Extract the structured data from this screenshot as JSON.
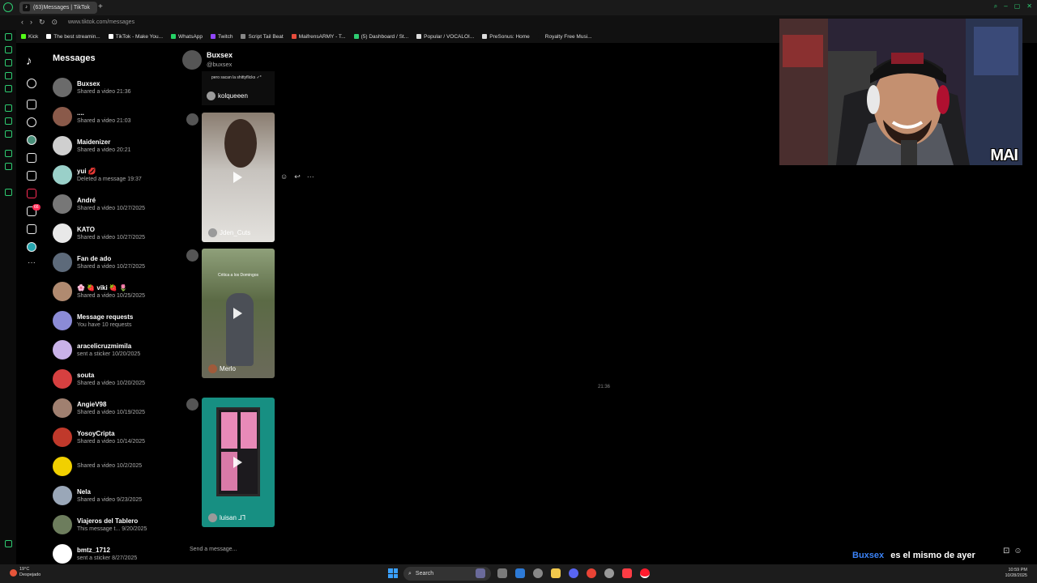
{
  "browser": {
    "tab_title": "(63)Messages | TikTok",
    "url": "www.tiktok.com/messages",
    "bookmarks": [
      {
        "label": "Kick",
        "color": "#53fc18"
      },
      {
        "label": "The best streamin...",
        "color": "#ffffff"
      },
      {
        "label": "TikTok - Make You...",
        "color": "#ffffff"
      },
      {
        "label": "WhatsApp",
        "color": "#25d366"
      },
      {
        "label": "Twitch",
        "color": "#9146ff"
      },
      {
        "label": "Script Tail Beat",
        "color": "#888888"
      },
      {
        "label": "MaifrensARMY - T...",
        "color": "#e74c3c"
      },
      {
        "label": "(5) Dashboard / St...",
        "color": "#2ecc71"
      },
      {
        "label": "Popular / VOCALOI...",
        "color": "#dddddd"
      },
      {
        "label": "PreSonus: Home",
        "color": "#dddddd"
      },
      {
        "label": "Royalty Free Musi...",
        "color": "#111111"
      }
    ]
  },
  "nav": {
    "notification_count": "66"
  },
  "messages": {
    "title": "Messages",
    "conversations": [
      {
        "name": "Buxsex",
        "sub": "Shared a video 21:36",
        "color": "#6b6b6b"
      },
      {
        "name": "....",
        "sub": "Shared a video 21:03",
        "color": "#8a5a4a"
      },
      {
        "name": "Maidenizer",
        "sub": "Shared a video 20:21",
        "color": "#cfcfcf"
      },
      {
        "name": "yui 💋",
        "sub": "Deleted a message 19:37",
        "color": "#9ad0c9"
      },
      {
        "name": "André",
        "sub": "Shared a video 10/27/2025",
        "color": "#777777"
      },
      {
        "name": "KATO",
        "sub": "Shared a video 10/27/2025",
        "color": "#e8e8e8"
      },
      {
        "name": "Fan de ado",
        "sub": "Shared a video 10/27/2025",
        "color": "#5d6a7a"
      },
      {
        "name": "🌸 🍓 viki 🍓 🌷",
        "sub": "Shared a video 10/25/2025",
        "color": "#b08a70"
      },
      {
        "name": "Message requests",
        "sub": "You have 10 requests",
        "color": "#8b8bd6"
      },
      {
        "name": "aracelicruzmimila",
        "sub": "sent a sticker 10/20/2025",
        "color": "#c9b2e8"
      },
      {
        "name": "souta",
        "sub": "Shared a video 10/20/2025",
        "color": "#d64040"
      },
      {
        "name": "AngieV98",
        "sub": "Shared a video 10/19/2025",
        "color": "#a08070"
      },
      {
        "name": "YosoyCripta",
        "sub": "Shared a video 10/14/2025",
        "color": "#c0392b"
      },
      {
        "name": "",
        "sub": "Shared a video 10/2/2025",
        "color": "#f1d000"
      },
      {
        "name": "Nela",
        "sub": "Shared a video 9/23/2025",
        "color": "#9aa7b8"
      },
      {
        "name": "Viajeros del Tablero",
        "sub": "This message t... 9/20/2025",
        "color": "#6d7d5d"
      },
      {
        "name": "bmtz_1712",
        "sub": "sent a sticker 8/27/2025",
        "color": "#ffffff"
      }
    ]
  },
  "chat": {
    "name": "Buxsex",
    "handle": "@buxsex",
    "prev_video": {
      "caption": "pero sacan la shittyflicks ✓*",
      "author": "kolqueeen"
    },
    "videos": [
      {
        "author": "Jden_Cuts",
        "caption": "",
        "bg": "#c9c6c2"
      },
      {
        "author": "Merlo",
        "caption": "Critica a los Domingos",
        "bg": "#5e6b48"
      },
      {
        "author": "luisan ⅃⅂",
        "caption": "",
        "bg": "#178f82"
      }
    ],
    "timestamp": "21:36",
    "compose_placeholder": "Send a message..."
  },
  "stream": {
    "cam_label": "MAI",
    "chat_user": "Buxsex",
    "chat_text": "es el mismo de ayer"
  },
  "taskbar": {
    "temperature": "19°C",
    "weather": "Despejado",
    "search_label": "Search",
    "time": "10:59 PM",
    "date": "10/28/2025"
  }
}
